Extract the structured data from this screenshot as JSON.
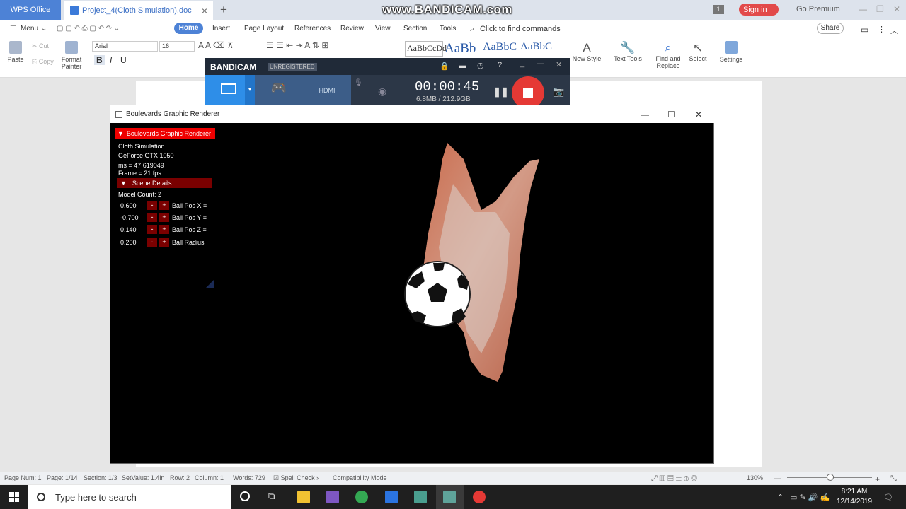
{
  "titlebar": {
    "wps_office_label": "WPS Office",
    "doc_tab_title": "Project_4(Cloth Simulation).doc",
    "new_tab": "+",
    "watermark": "www.BANDICAM.com",
    "notif_count": "1",
    "sign_in": "Sign in",
    "go_premium": "Go Premium"
  },
  "menubar": {
    "menu": "Menu",
    "tabs": [
      "Home",
      "Insert",
      "Page Layout",
      "References",
      "Review",
      "View",
      "Section",
      "Tools"
    ],
    "find_commands": "Click to find commands",
    "share": "Share"
  },
  "ribbon": {
    "paste": "Paste",
    "cut": "Cut",
    "copy": "Copy",
    "format_painter_1": "Format",
    "format_painter_2": "Painter",
    "font_name": "Arial",
    "font_size": "16",
    "styles": [
      "AaBbCcDd",
      "AaBb",
      "AaBbC",
      "AaBbC"
    ],
    "new_style": "New Style",
    "text_tools": "Text Tools",
    "find_replace_1": "Find and",
    "find_replace_2": "Replace",
    "select": "Select",
    "settings": "Settings"
  },
  "bandicam": {
    "logo": "BANDICAM",
    "registration": "UNREGISTERED",
    "timer": "00:00:45",
    "file_size": "6.8MB / 212.9GB",
    "hdmi": "HDMI",
    "help": "?"
  },
  "renderer": {
    "window_title": "Boulevards Graphic Renderer",
    "panel_title": "Boulevards Graphic Renderer",
    "app_name": "Cloth Simulation",
    "gpu": "GeForce GTX 1050",
    "ms": "ms = 47.619049",
    "frame": "Frame = 21 fps",
    "scene_details": "Scene Details",
    "model_count": "Model Count: 2",
    "params": [
      {
        "value": "0.600",
        "label": "Ball Pos X ="
      },
      {
        "value": "-0.700",
        "label": "Ball Pos Y ="
      },
      {
        "value": "0.140",
        "label": "Ball Pos Z ="
      },
      {
        "value": "0.200",
        "label": "Ball Radius"
      }
    ],
    "minus": "-",
    "plus": "+"
  },
  "statusbar": {
    "page_num": "Page Num: 1",
    "page": "Page: 1/14",
    "section": "Section: 1/3",
    "set_value": "SetValue: 1.4in",
    "row": "Row: 2",
    "column": "Column: 1",
    "words": "Words: 729",
    "spell_check": "Spell Check",
    "compat": "Compatibility Mode",
    "zoom": "130%"
  },
  "taskbar": {
    "search_placeholder": "Type here to search",
    "time": "8:21 AM",
    "date": "12/14/2019"
  }
}
